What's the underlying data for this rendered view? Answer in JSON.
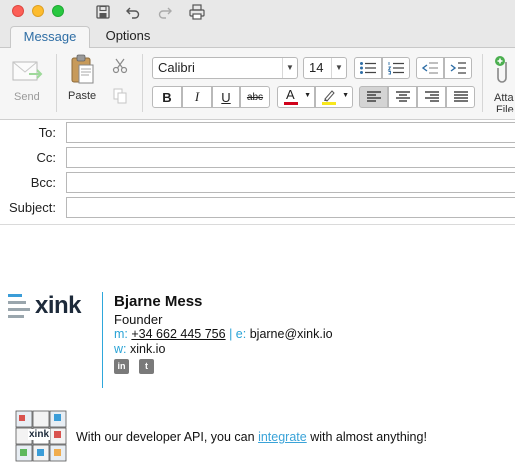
{
  "toolbar": {
    "tabs": [
      {
        "label": "Message"
      },
      {
        "label": "Options"
      }
    ],
    "send_label": "Send",
    "paste_label": "Paste",
    "attach_label_line1": "Atta",
    "attach_label_line2": "File",
    "font": {
      "value": "Calibri"
    },
    "size": {
      "value": "14"
    },
    "format": {
      "bold": "B",
      "italic": "I",
      "underline": "U",
      "strike": "abc"
    },
    "font_color_glyph": "A",
    "font_color": "#d0021b",
    "highlight_color": "#f8e71c"
  },
  "headers": {
    "to_label": "To:",
    "cc_label": "Cc:",
    "bcc_label": "Bcc:",
    "subject_label": "Subject:",
    "to_value": "",
    "cc_value": "",
    "bcc_value": "",
    "subject_value": ""
  },
  "signature": {
    "logo_text": "xink",
    "name": "Bjarne Mess",
    "title": "Founder",
    "m_label": "m:",
    "phone": "+34 662 445 756",
    "separator": "|",
    "e_label": "e:",
    "email": "bjarne@xink.io",
    "w_label": "w:",
    "website": "xink.io",
    "accent_color": "#29a3d6",
    "social": [
      {
        "icon": "linkedin-icon",
        "glyph": "in"
      },
      {
        "icon": "twitter-icon",
        "glyph": "t"
      }
    ],
    "cube_label": "xink",
    "promo_before": "With our developer API, you can",
    "promo_link": "integrate",
    "promo_after": "with almost anything!"
  }
}
